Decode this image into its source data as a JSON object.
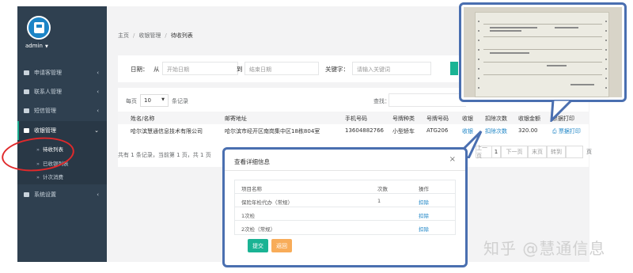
{
  "sidebar": {
    "user": "admin",
    "items": [
      {
        "label": "申请客管理",
        "icon": "edit-icon"
      },
      {
        "label": "联系人管理",
        "icon": "user-icon"
      },
      {
        "label": "短信管理",
        "icon": "mail-icon"
      },
      {
        "label": "收银管理",
        "icon": "yen-icon"
      },
      {
        "label": "系统设置",
        "icon": "gear-icon"
      }
    ],
    "submenu": [
      "待收列表",
      "已收银列表",
      "计次消费"
    ]
  },
  "breadcrumb": [
    "主页",
    "收银管理",
    "待收列表"
  ],
  "filter": {
    "date_label": "日期：",
    "from_label": "从",
    "start_placeholder": "开始日期",
    "to_label": "到",
    "end_placeholder": "结束日期",
    "keyword_label": "关键字：",
    "keyword_placeholder": "请输入关键词"
  },
  "table": {
    "show_prefix": "每页",
    "page_size": "10",
    "show_suffix": "条记录",
    "search_label": "查找：",
    "headers": [
      "姓名/名称",
      "邮寄地址",
      "手机号码",
      "号牌种类",
      "号牌号码",
      "收银",
      "扣除次数",
      "收银金额",
      "票据打印"
    ],
    "row": [
      "哈尔滨慧通信息技术有限公司",
      "哈尔滨市经开区南岗集中区18栋804室",
      "13604882766",
      "小型轿车",
      "ATG206",
      "收银",
      "扣除次数",
      "320.00",
      "票据打印"
    ],
    "summary": "共有 1 条记录，当前第 1 页，共 1 页",
    "pager": [
      "上一页",
      "1",
      "下一页",
      "末页",
      "转到",
      "页"
    ]
  },
  "modal": {
    "title": "查看详细信息",
    "close": "×",
    "headers": [
      "项目名称",
      "次数",
      "操作"
    ],
    "rows": [
      {
        "name": "保险年检代办（常规）",
        "count": "1",
        "action": "扣除"
      },
      {
        "name": "1次检",
        "count": "",
        "action": "扣除"
      },
      {
        "name": "2次检（常规）",
        "count": "",
        "action": "扣除"
      }
    ],
    "submit": "提交",
    "cancel": "返回"
  },
  "watermark": "知乎 @慧通信息",
  "colors": {
    "sidebar": "#2f4050",
    "accent": "#1ab394",
    "link": "#1c84c6",
    "warning": "#f8ac59",
    "annotation_red": "#e0292b",
    "callout_border": "#4a6fb0"
  }
}
